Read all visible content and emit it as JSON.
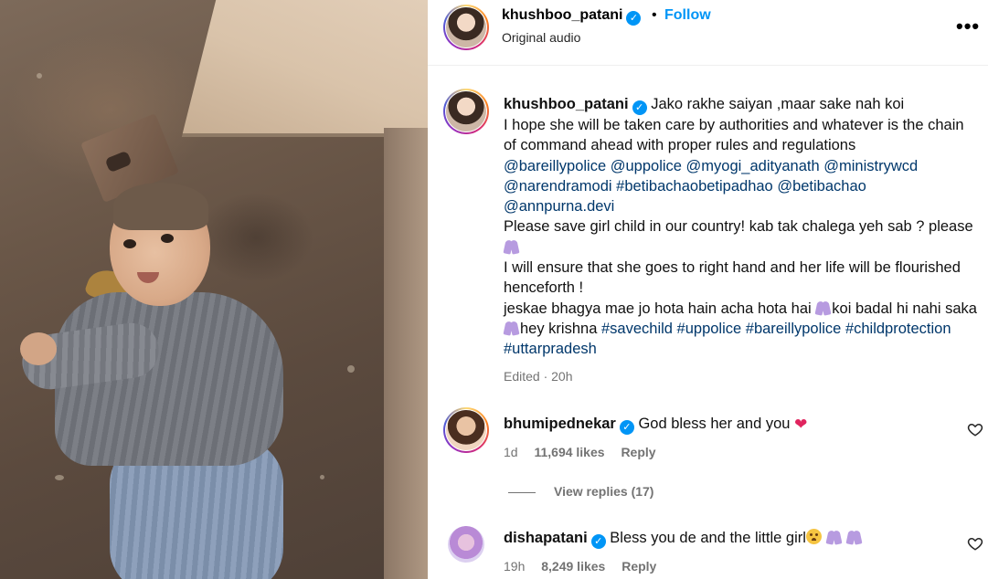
{
  "post": {
    "username": "khushboo_patani",
    "dot": "•",
    "follow_label": "Follow",
    "audio": "Original audio",
    "more": "•••"
  },
  "caption": {
    "username": "khushboo_patani",
    "line1": "Jako rakhe saiyan ,maar sake nah koi",
    "line2": "I hope she will be taken care by authorities and whatever is the chain of command ahead with proper rules and regulations",
    "mentions": [
      "@bareillypolice",
      "@uppolice",
      "@myogi_adityanath",
      "@ministrywcd",
      "@narendramodi",
      "#betibachaobetipadhao",
      "@betibachao",
      "@annpurna.devi"
    ],
    "line3": "Please save girl child in our country! kab tak chalega yeh sab ? please",
    "line4": "I will ensure that she goes to right hand and her life will be flourished henceforth !",
    "line5a": "jeskae bhagya mae jo hota hain acha hota hai",
    "line5b": "koi badal hi nahi saka",
    "line5c": "hey krishna",
    "tags": [
      "#savechild",
      "#uppolice",
      "#bareillypolice",
      "#childprotection",
      "#uttarpradesh"
    ],
    "meta": "Edited · 20h"
  },
  "comments": [
    {
      "username": "bhumipednekar",
      "text": "God bless her and you",
      "emoji": "heart",
      "time": "1d",
      "likes": "11,694 likes",
      "reply": "Reply",
      "view_replies": "View replies (17)"
    },
    {
      "username": "dishapatani",
      "text": "Bless you de and the little girl",
      "emoji": "pleading-face, folded-hands x2",
      "time": "19h",
      "likes": "8,249 likes",
      "reply": "Reply"
    }
  ],
  "icons": {
    "verified": "verified-badge-icon",
    "like": "heart-outline-icon"
  },
  "colors": {
    "link": "#00376b",
    "follow": "#0095f6",
    "verified": "#0095f6",
    "muted": "#737373"
  }
}
